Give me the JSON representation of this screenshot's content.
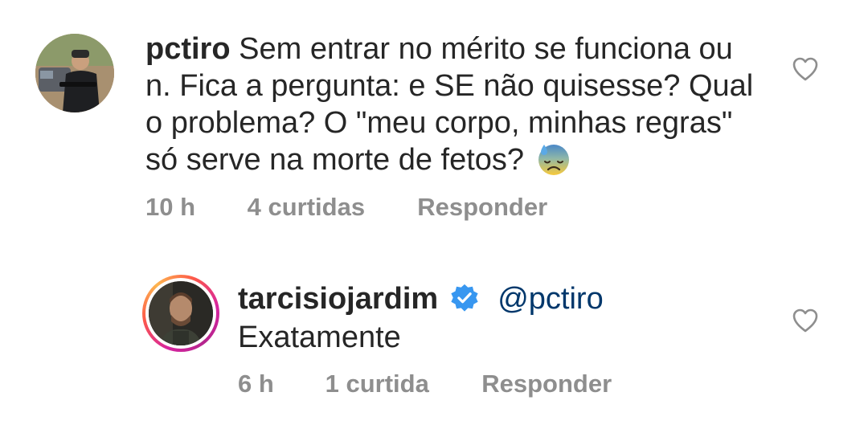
{
  "comments": [
    {
      "username": "pctiro",
      "text": "Sem entrar no mérito se funciona ou n. Fica a pergunta: e SE não quisesse? Qual o problema? O \"meu corpo, minhas regras\" só serve na morte de fetos?",
      "emoji": "downcast-face-with-sweat",
      "time": "10 h",
      "likes": "4 curtidas",
      "reply_label": "Responder",
      "liked": false
    },
    {
      "username": "tarcisiojardim",
      "verified": true,
      "mention": "@pctiro",
      "text": "Exatamente",
      "time": "6 h",
      "likes": "1 curtida",
      "reply_label": "Responder",
      "liked": false
    }
  ],
  "colors": {
    "text": "#262626",
    "meta": "#8e8e8e",
    "mention": "#00376b",
    "verified": "#3897f0",
    "story_ring": "#d6249f"
  }
}
